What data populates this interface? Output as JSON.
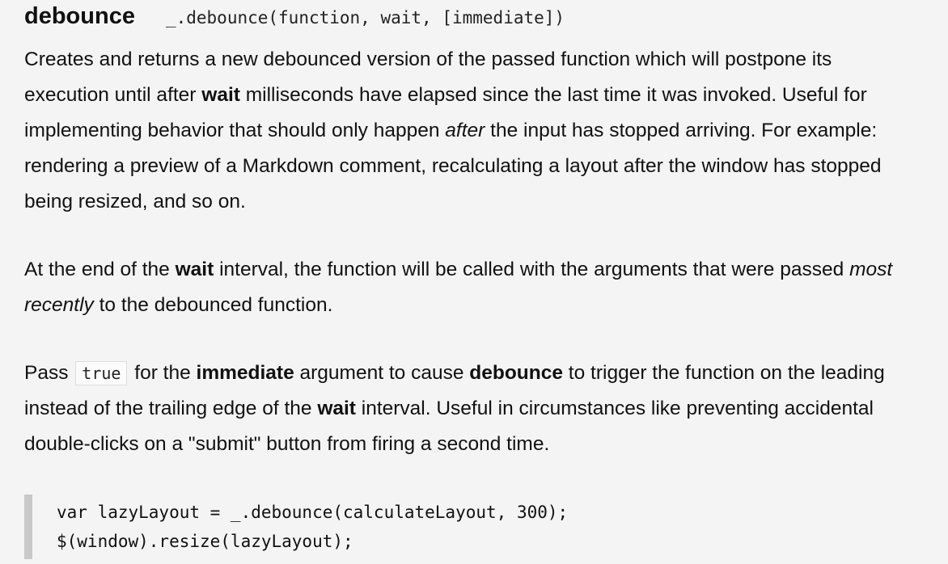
{
  "header": {
    "name": "debounce",
    "signature": "_.debounce(function, wait, [immediate])"
  },
  "para1": {
    "t1": "Creates and returns a new debounced version of the passed function which will postpone its execution until after ",
    "b1": "wait",
    "t2": " milliseconds have elapsed since the last time it was invoked. Useful for implementing behavior that should only happen ",
    "i1": "after",
    "t3": " the input has stopped arriving. For example: rendering a preview of a Markdown comment, recalculating a layout after the window has stopped being resized, and so on."
  },
  "para2": {
    "t1": "At the end of the ",
    "b1": "wait",
    "t2": " interval, the function will be called with the arguments that were passed ",
    "i1": "most recently",
    "t3": " to the debounced function."
  },
  "para3": {
    "t1": "Pass ",
    "code": "true",
    "t2": " for the ",
    "b1": "immediate",
    "t3": " argument to cause ",
    "b2": "debounce",
    "t4": " to trigger the function on the leading instead of the trailing edge of the ",
    "b3": "wait",
    "t5": " interval. Useful in circumstances like preventing accidental double-clicks on a \"submit\" button from firing a second time."
  },
  "code_block": {
    "lines": [
      "var lazyLayout = _.debounce(calculateLayout, 300);",
      "$(window).resize(lazyLayout);"
    ]
  }
}
